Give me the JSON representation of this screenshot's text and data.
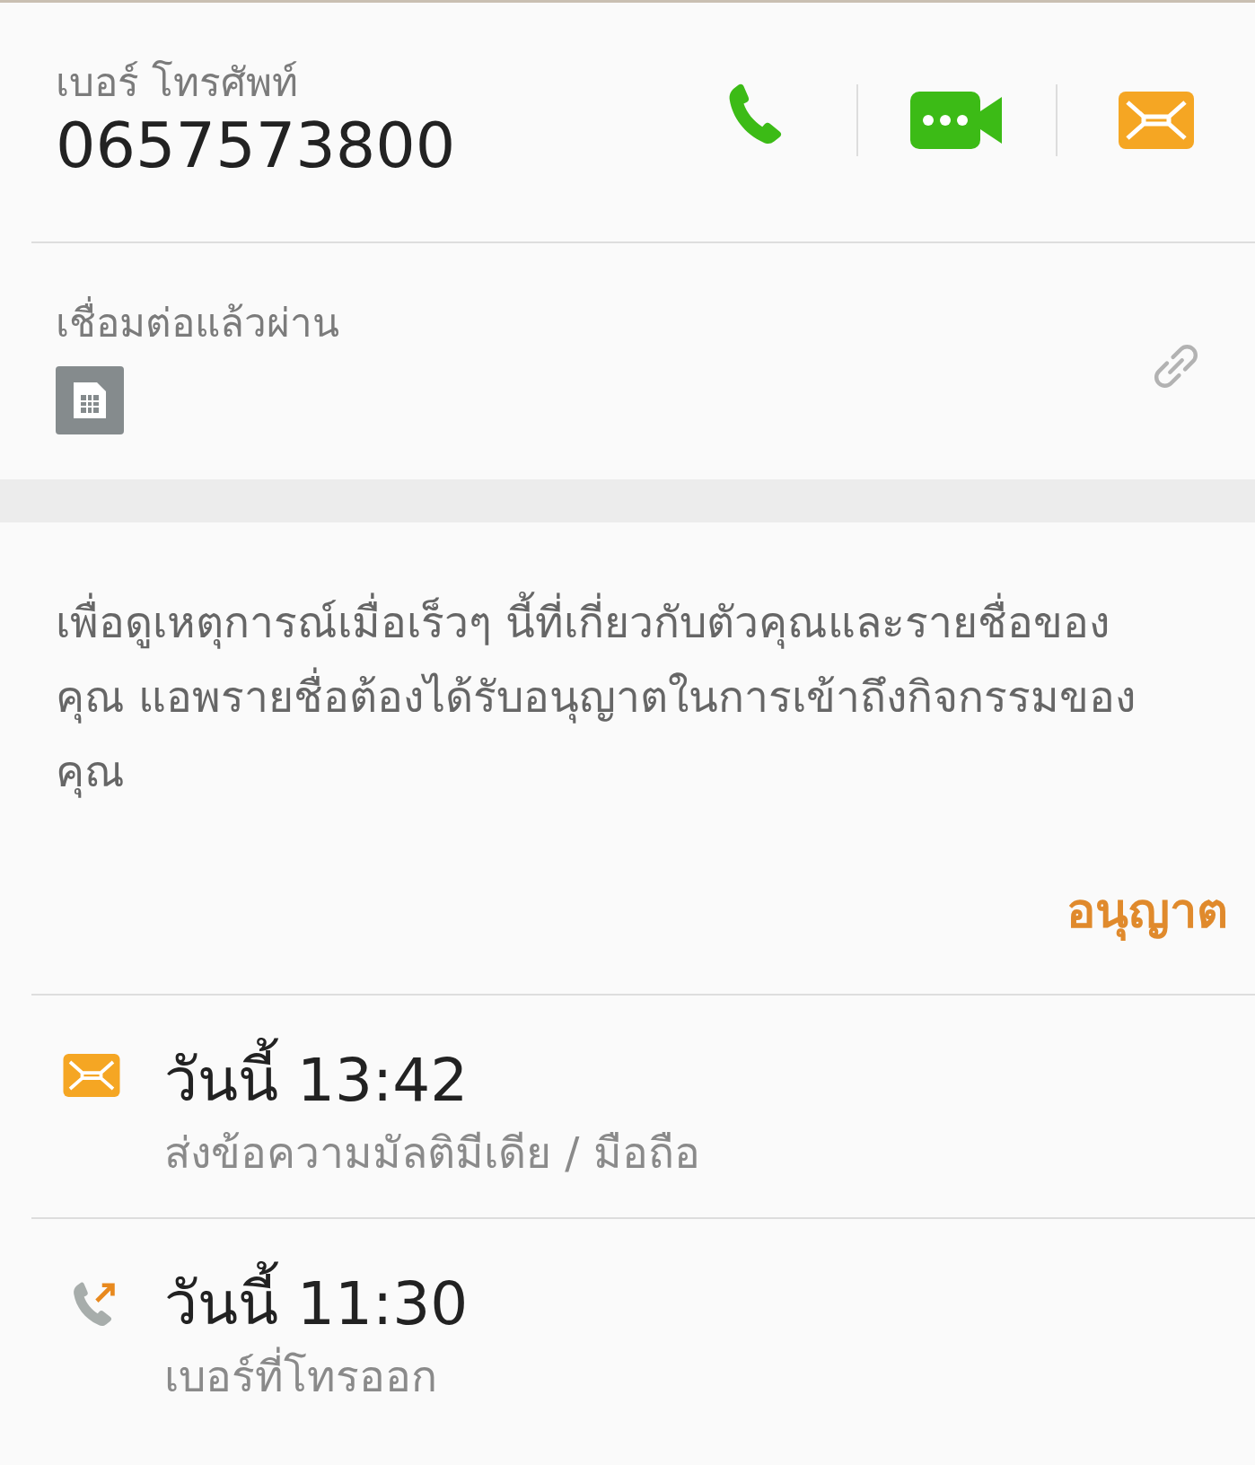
{
  "phone": {
    "label": "เบอร์ โทรศัพท์",
    "number": "0657573800"
  },
  "connection": {
    "label": "เชื่อมต่อแล้วผ่าน"
  },
  "permission": {
    "message": "เพื่อดูเหตุการณ์เมื่อเร็วๆ นี้ที่เกี่ยวกับตัวคุณและรายชื่อของคุณ แอพรายชื่อต้องได้รับอนุญาตในการเข้าถึงกิจกรรมของคุณ",
    "action": "อนุญาต"
  },
  "history": [
    {
      "kind": "message",
      "time": "วันนี้ 13:42",
      "detail": "ส่งข้อความมัลติมีเดีย / มือถือ"
    },
    {
      "kind": "outgoing_call",
      "time": "วันนี้ 11:30",
      "detail": "เบอร์ที่โทรออก"
    }
  ]
}
